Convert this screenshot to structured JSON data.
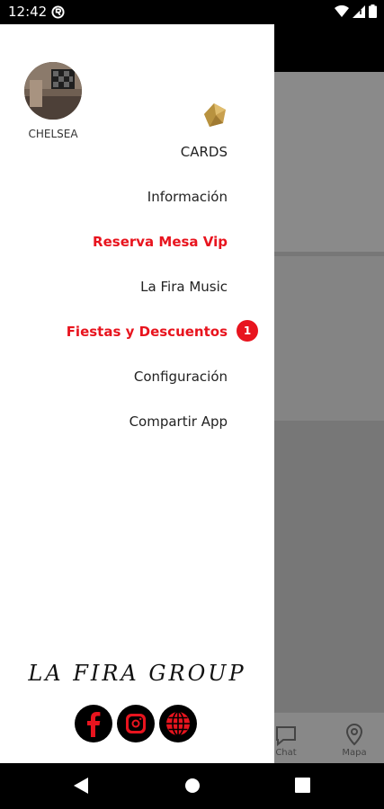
{
  "status_bar": {
    "time": "12:42"
  },
  "drawer": {
    "user": {
      "name": "CHELSEA"
    },
    "menu": [
      {
        "label": "CARDS",
        "highlight": false
      },
      {
        "label": "Información",
        "highlight": false
      },
      {
        "label": "Reserva Mesa Vip",
        "highlight": true
      },
      {
        "label": "La Fira Music",
        "highlight": false
      },
      {
        "label": "Fiestas y Descuentos",
        "highlight": true,
        "badge": "1"
      },
      {
        "label": "Configuración",
        "highlight": false
      },
      {
        "label": "Compartir App",
        "highlight": false
      }
    ],
    "brand": "LA FIRA GROUP",
    "social_icons": [
      "facebook-icon",
      "instagram-icon",
      "web-globe-icon"
    ]
  },
  "background_app": {
    "bottom_nav": [
      {
        "label": "Chat",
        "icon": "chat-icon"
      },
      {
        "label": "Mapa",
        "icon": "map-pin-icon"
      }
    ]
  },
  "colors": {
    "accent_red": "#e8141e",
    "drawer_bg": "#ffffff",
    "scrim": "#777777",
    "gold": "#b8923f"
  }
}
